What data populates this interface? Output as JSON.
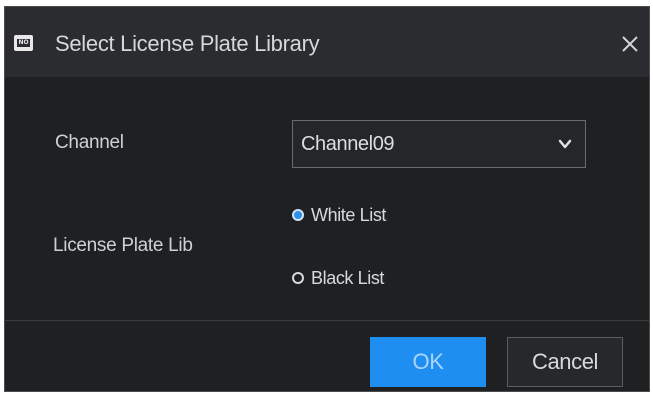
{
  "dialog": {
    "title": "Select License Plate Library",
    "title_icon": "no-entry-icon",
    "close_icon": "close-icon"
  },
  "form": {
    "channel": {
      "label": "Channel",
      "value": "Channel09",
      "chevron_icon": "chevron-down-icon"
    },
    "license_plate_lib": {
      "label": "License Plate Lib",
      "options": [
        {
          "label": "White List",
          "checked": true
        },
        {
          "label": "Black List",
          "checked": false
        }
      ]
    }
  },
  "buttons": {
    "ok_label": "OK",
    "cancel_label": "Cancel"
  },
  "colors": {
    "accent": "#1e8ff0",
    "background": "#1f2022",
    "titlebar": "#2b2c2f"
  }
}
